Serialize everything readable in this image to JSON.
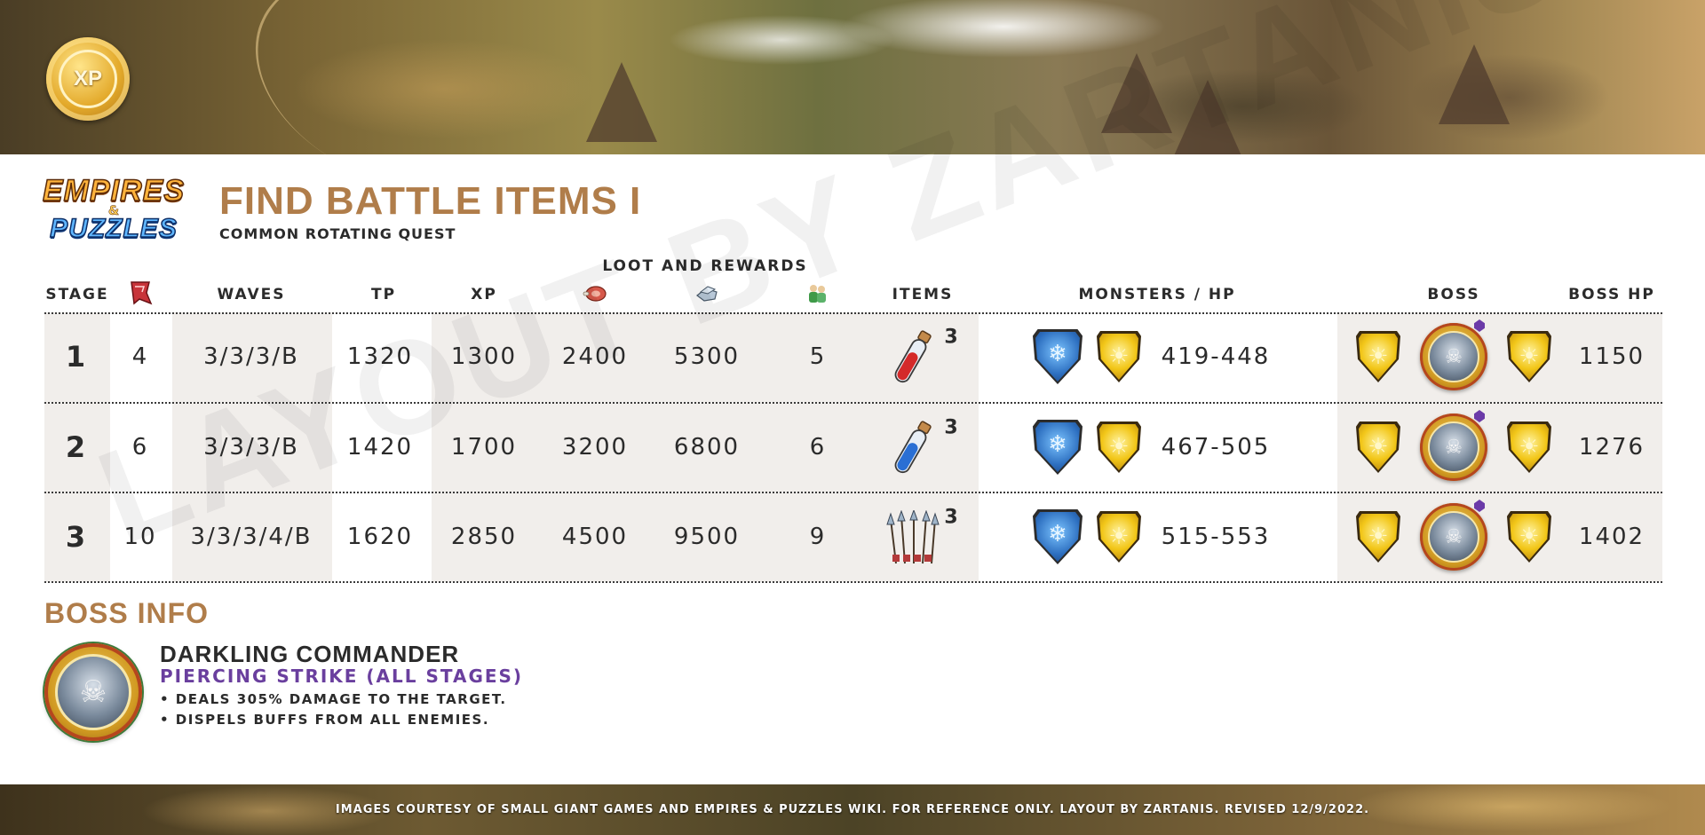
{
  "banner": {
    "xp_badge": "XP"
  },
  "logo": {
    "line1": "EMPIRES",
    "amp": "&",
    "line2": "PUZZLES"
  },
  "header": {
    "title": "FIND BATTLE ITEMS I",
    "subtitle": "COMMON ROTATING QUEST"
  },
  "table": {
    "group_header": "LOOT AND REWARDS",
    "columns": {
      "stage": "STAGE",
      "energy_icon": "flag-icon",
      "waves": "WAVES",
      "tp": "TP",
      "xp": "XP",
      "food_icon": "meat-icon",
      "iron_icon": "iron-icon",
      "recruit_icon": "recruit-icon",
      "items": "ITEMS",
      "monsters": "MONSTERS / HP",
      "boss": "BOSS",
      "boss_hp": "BOSS HP"
    },
    "rows": [
      {
        "stage": "1",
        "energy": "4",
        "waves": "3/3/3/B",
        "tp": "1320",
        "xp": "1300",
        "food": "2400",
        "iron": "5300",
        "recruits": "5",
        "item_icon": "red-potion-icon",
        "item_count": "3",
        "monster_hp": "419-448",
        "boss_hp": "1150"
      },
      {
        "stage": "2",
        "energy": "6",
        "waves": "3/3/3/B",
        "tp": "1420",
        "xp": "1700",
        "food": "3200",
        "iron": "6800",
        "recruits": "6",
        "item_icon": "blue-potion-icon",
        "item_count": "3",
        "monster_hp": "467-505",
        "boss_hp": "1276"
      },
      {
        "stage": "3",
        "energy": "10",
        "waves": "3/3/3/4/B",
        "tp": "1620",
        "xp": "2850",
        "food": "4500",
        "iron": "9500",
        "recruits": "9",
        "item_icon": "arrows-icon",
        "item_count": "3",
        "monster_hp": "515-553",
        "boss_hp": "1402"
      }
    ]
  },
  "boss_info": {
    "heading": "BOSS INFO",
    "name": "DARKLING COMMANDER",
    "skill": "PIERCING STRIKE (ALL STAGES)",
    "effects": [
      "• DEALS 305% DAMAGE TO THE TARGET.",
      "• DISPELS BUFFS FROM ALL ENEMIES."
    ]
  },
  "watermark": "LAYOUT BY ZARTANIS",
  "footer": {
    "text": "IMAGES COURTESY OF SMALL GIANT GAMES AND EMPIRES & PUZZLES WIKI. FOR REFERENCE ONLY. LAYOUT BY ZARTANIS. REVISED 12/9/2022."
  },
  "colors": {
    "title_accent": "#b07d4a",
    "skill_purple": "#6a3f9e",
    "row_shade": "#f1eeeb"
  }
}
